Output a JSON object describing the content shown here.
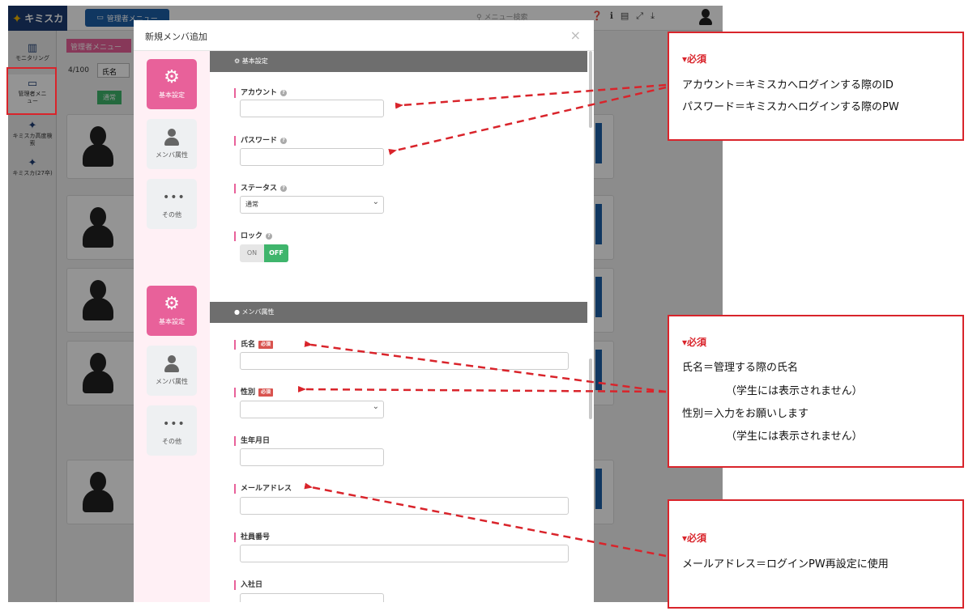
{
  "app": {
    "logo": "キミスカ",
    "admin_tab": "管理者メニュー",
    "search_placeholder": "メニュー検索",
    "nav": [
      {
        "label": "モニタリング",
        "icon": "chart-icon"
      },
      {
        "label": "管理者メニュー",
        "icon": "monitor-icon"
      },
      {
        "label": "キミスカ高度検索",
        "icon": "kimisuka-icon"
      },
      {
        "label": "キミスカ(27卒)",
        "icon": "kimisuka-icon"
      }
    ],
    "page_title": "管理者メニュー",
    "count": "4/100",
    "filter_value": "氏名",
    "status_button": "通常"
  },
  "modal": {
    "title": "新規メンバ追加",
    "close": "×",
    "side_buttons": [
      {
        "label": "基本設定",
        "icon": "gear-icon"
      },
      {
        "label": "メンバ属性",
        "icon": "user-icon"
      },
      {
        "label": "その他",
        "icon": "dots-icon"
      }
    ],
    "side_buttons_repeat": [
      {
        "label": "基本設定",
        "icon": "gear-icon"
      },
      {
        "label": "メンバ属性",
        "icon": "user-icon"
      },
      {
        "label": "その他",
        "icon": "dots-icon"
      }
    ],
    "section_basic": {
      "title": "基本設定",
      "account_label": "アカウント",
      "password_label": "パスワード",
      "status_label": "ステータス",
      "status_value": "通常",
      "lock_label": "ロック",
      "lock_on": "ON",
      "lock_off": "OFF"
    },
    "section_member": {
      "title": "メンバ属性",
      "name_label": "氏名",
      "gender_label": "性別",
      "required_badge": "必須",
      "birthday_label": "生年月日",
      "email_label": "メールアドレス",
      "employee_no_label": "社員番号",
      "join_date_label": "入社日"
    }
  },
  "annotations": {
    "note1": {
      "tag": "▾必須",
      "lines": [
        "アカウント＝キミスカへログインする際のID",
        "パスワード＝キミスカへログインする際のPW"
      ]
    },
    "note2": {
      "tag": "▾必須",
      "lines": [
        "氏名＝管理する際の氏名",
        "（学生には表示されません）",
        "性別＝入力をお願いします",
        "（学生には表示されません）"
      ]
    },
    "note3": {
      "tag": "▾必須",
      "lines": [
        "メールアドレス＝ログインPW再設定に使用"
      ]
    },
    "accent_color": "#d9242b",
    "pink_color": "#e8619a"
  }
}
